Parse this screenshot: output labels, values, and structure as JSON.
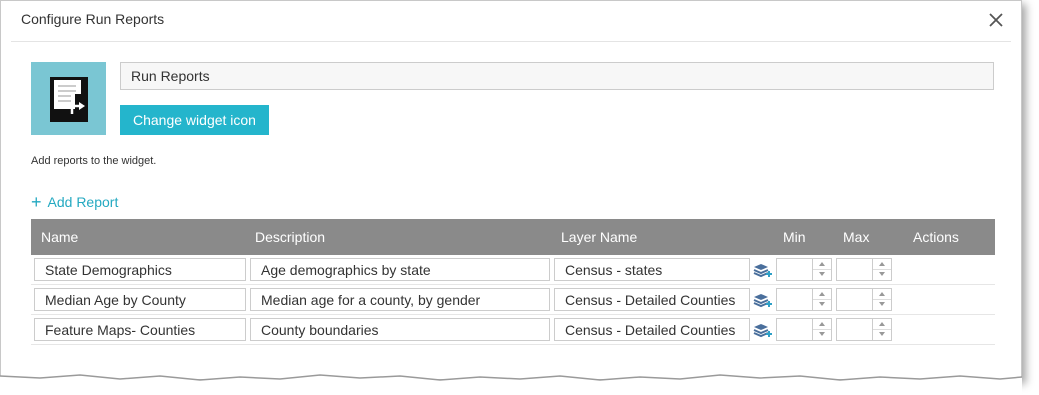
{
  "dialog": {
    "title": "Configure Run Reports",
    "widget_name": "Run Reports",
    "change_icon_label": "Change widget icon",
    "hint": "Add reports to the widget.",
    "add_report_label": "Add Report"
  },
  "grid": {
    "columns": [
      "Name",
      "Description",
      "Layer Name",
      "Min",
      "Max",
      "Actions"
    ],
    "rows": [
      {
        "name": "State Demographics",
        "description": "Age demographics by state",
        "layer": "Census - states",
        "min": "",
        "max": ""
      },
      {
        "name": "Median Age by County",
        "description": "Median age for a county, by gender",
        "layer": "Census - Detailed Counties",
        "min": "",
        "max": ""
      },
      {
        "name": "Feature Maps- Counties",
        "description": "County boundaries",
        "layer": "Census - Detailed Counties",
        "min": "",
        "max": ""
      }
    ]
  },
  "icons": {
    "close": "close-icon",
    "widget": "report-document-icon",
    "add": "plus-icon",
    "layer": "layers-add-icon",
    "spin_up": "spin-up-icon",
    "spin_down": "spin-down-icon"
  },
  "colors": {
    "accent": "#24b5cc",
    "link": "#24a9c1",
    "icon_bg": "#7ac6d3",
    "header_bg": "#8a8a8a"
  }
}
